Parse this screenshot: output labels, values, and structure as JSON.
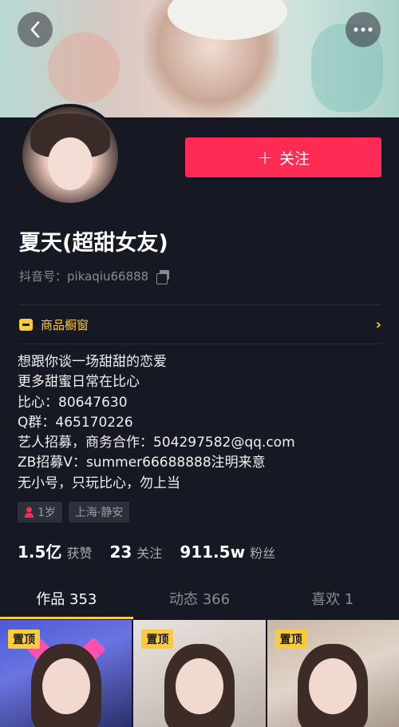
{
  "header": {
    "back_icon": "chevron-left-icon",
    "more_icon": "more-dots-icon"
  },
  "profile": {
    "name": "夏天(超甜女友)",
    "douyin_id": "抖音号：pikaqiu66888",
    "follow_label": "关注",
    "follow_icon": "+",
    "follow_color": "#fe2c55"
  },
  "shop": {
    "label": "商品橱窗",
    "chevron": "›",
    "color": "#facb3d"
  },
  "bio": {
    "lines": [
      "想跟你谈一场甜甜的恋爱",
      "更多甜蜜日常在比心",
      "比心：80647630",
      "Q群：465170226",
      "艺人招募，商务合作：504297582@qq.com",
      "ZB招募V：summer66688888注明来意",
      "无小号，只玩比心，勿上当"
    ]
  },
  "tags": {
    "gender_icon": "female-icon",
    "age": "1岁",
    "location": "上海·静安"
  },
  "stats": {
    "likes_num": "1.5亿",
    "likes_label": "获赞",
    "following_num": "23",
    "following_label": "关注",
    "fans_num": "911.5w",
    "fans_label": "粉丝"
  },
  "tabs": [
    {
      "label": "作品 353",
      "active": true
    },
    {
      "label": "动态 366",
      "active": false
    },
    {
      "label": "喜欢 1",
      "active": false
    }
  ],
  "videos": [
    {
      "badge": "置顶"
    },
    {
      "badge": "置顶"
    },
    {
      "badge": "置顶"
    }
  ]
}
